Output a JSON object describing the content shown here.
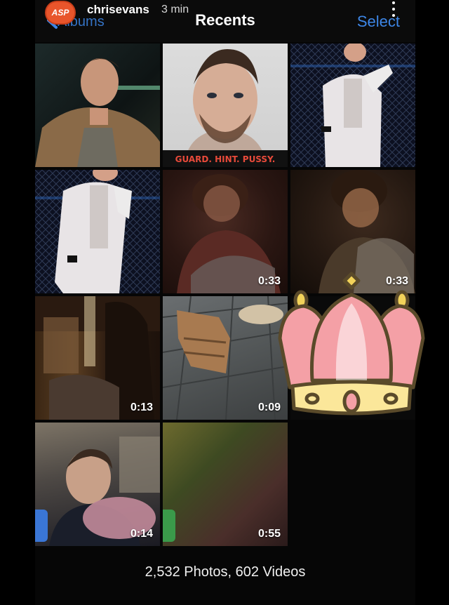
{
  "story": {
    "avatar_text": "ASP",
    "username": "chrisevans",
    "time": "3 min"
  },
  "header": {
    "back_label": "Albums",
    "title": "Recents",
    "select_label": "Select"
  },
  "tiles": [
    {
      "kind": "photo",
      "duration": ""
    },
    {
      "kind": "photo",
      "duration": "",
      "caption": "GUARD. HINT. PUSSY."
    },
    {
      "kind": "photo",
      "duration": ""
    },
    {
      "kind": "photo",
      "duration": ""
    },
    {
      "kind": "video",
      "duration": "0:33"
    },
    {
      "kind": "video",
      "duration": "0:33"
    },
    {
      "kind": "video",
      "duration": "0:13"
    },
    {
      "kind": "video",
      "duration": "0:09"
    },
    {
      "kind": "video",
      "duration": "0:14"
    },
    {
      "kind": "video",
      "duration": "0:55"
    }
  ],
  "footer": {
    "count_text": "2,532 Photos, 602 Videos"
  },
  "colors": {
    "accent_blue": "#3d86e6",
    "avatar_orange": "#e8552b",
    "crown_pink": "#f4a0a6",
    "crown_gold": "#f2d25a"
  },
  "icons": [
    "back-chevron-icon",
    "more-dots-icon",
    "crown-sticker-icon"
  ]
}
